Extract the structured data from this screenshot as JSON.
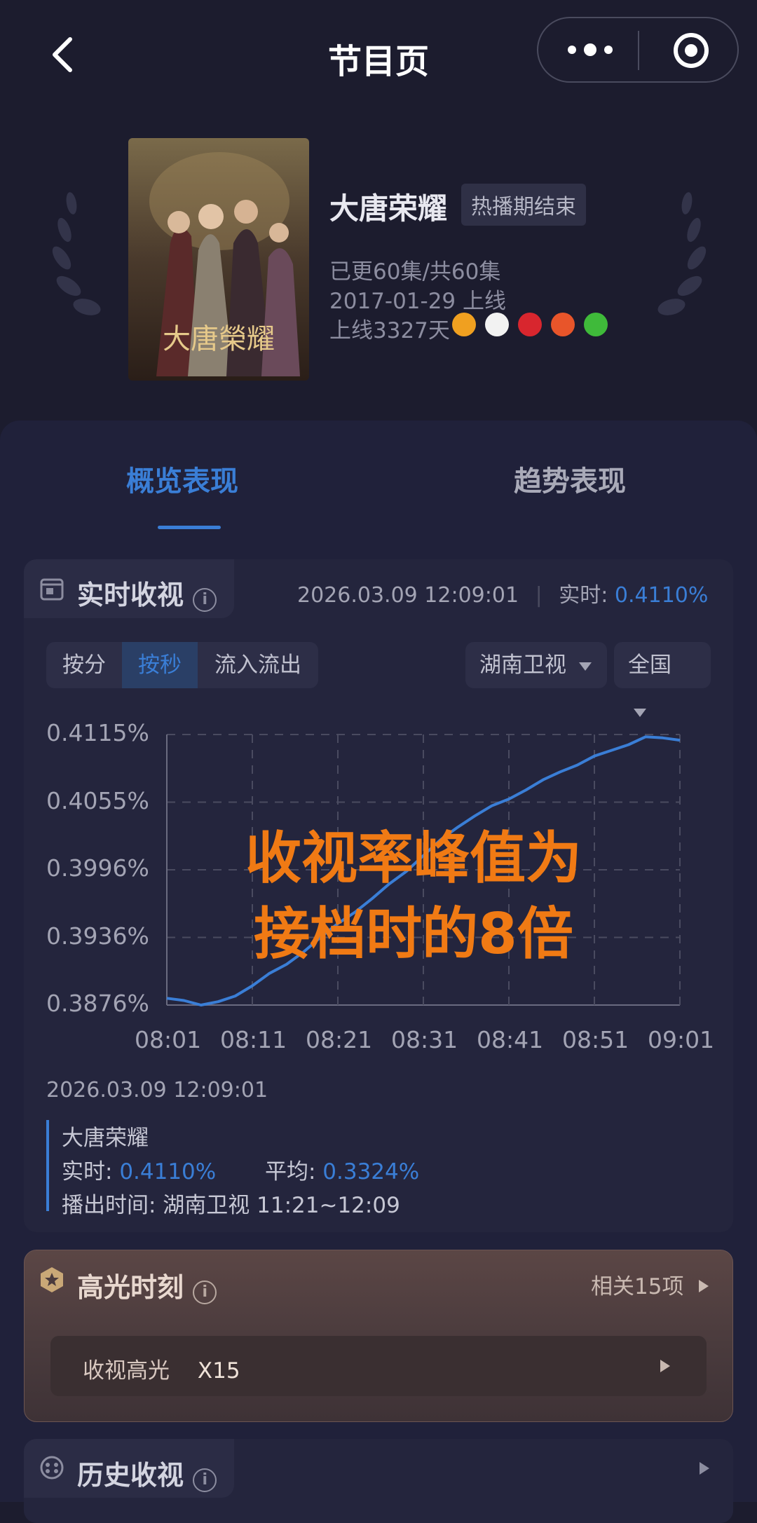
{
  "nav": {
    "title": "节目页"
  },
  "show": {
    "title": "大唐荣耀",
    "status_badge": "热播期结束",
    "episodes": "已更60集/共60集",
    "premiere": "2017-01-29 上线",
    "days_online": "上线3327天",
    "poster_title": "大唐榮耀",
    "channel_icons": [
      "hunan-tv-icon",
      "cctv-icon",
      "anhui-tv-icon",
      "dragon-tv-icon",
      "iqiyi-icon"
    ]
  },
  "tabs": {
    "active": "概览表现",
    "other": "趋势表现"
  },
  "realtime": {
    "title": "实时收视",
    "timestamp": "2026.03.09 12:09:01",
    "realtime_label": "实时:",
    "realtime_value": "0.4110%",
    "segments": [
      "按分",
      "按秒",
      "流入流出"
    ],
    "selected_segment": "按秒",
    "channel_dropdown": "湖南卫视",
    "region_dropdown": "全国"
  },
  "chart_data": {
    "type": "line",
    "title": "",
    "xlabel": "",
    "ylabel": "",
    "x_ticks": [
      "08:01",
      "08:11",
      "08:21",
      "08:31",
      "08:41",
      "08:51",
      "09:01"
    ],
    "y_ticks": [
      "0.4115%",
      "0.4055%",
      "0.3996%",
      "0.3936%",
      "0.3876%"
    ],
    "ylim": [
      0.3876,
      0.4115
    ],
    "grid": true,
    "series": [
      {
        "x": [
          "08:01",
          "08:03",
          "08:05",
          "08:07",
          "08:09",
          "08:11",
          "08:13",
          "08:15",
          "08:17",
          "08:19",
          "08:21",
          "08:23",
          "08:25",
          "08:27",
          "08:29",
          "08:31",
          "08:33",
          "08:35",
          "08:37",
          "08:39",
          "08:41",
          "08:43",
          "08:45",
          "08:47",
          "08:49",
          "08:51",
          "08:53",
          "08:55",
          "08:57",
          "08:59",
          "09:01"
        ],
        "values": [
          0.3882,
          0.388,
          0.3876,
          0.3879,
          0.3884,
          0.3893,
          0.3904,
          0.3912,
          0.3923,
          0.3936,
          0.3948,
          0.3958,
          0.397,
          0.3983,
          0.3994,
          0.4008,
          0.4022,
          0.4033,
          0.4043,
          0.4052,
          0.4058,
          0.4066,
          0.4075,
          0.4082,
          0.4088,
          0.4096,
          0.4101,
          0.4106,
          0.4113,
          0.4112,
          0.411
        ]
      }
    ]
  },
  "overlay": {
    "line1": "收视率峰值为",
    "line2": "接档时的8倍"
  },
  "footer": {
    "date": "2026.03.09 12:09:01",
    "show_name": "大唐荣耀",
    "realtime_label": "实时:",
    "realtime_value": "0.4110%",
    "avg_label": "平均:",
    "avg_value": "0.3324%",
    "airing": "播出时间:  湖南卫视 11:21~12:09"
  },
  "highlight": {
    "title": "高光时刻",
    "related": "相关15项",
    "row_label": "收视高光",
    "row_value": "X15"
  },
  "history": {
    "title": "历史收视"
  }
}
